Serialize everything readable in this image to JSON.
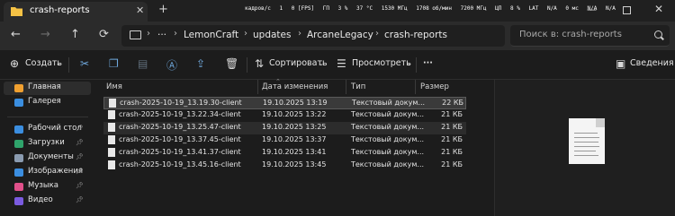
{
  "window": {
    "tab_title": "crash-reports",
    "tab_close_glyph": "✕",
    "new_tab_glyph": "+",
    "minimize_glyph": "—",
    "close_glyph": "✕"
  },
  "overlay": {
    "items": [
      "кадров/с",
      "1",
      "0 [FPS]",
      "ГП",
      "3 %",
      "37 °C",
      "1530 МГц",
      "1708 об/мин",
      "7200 МГц",
      "ЦП",
      "8 %",
      "LAT",
      "N/A",
      "0 мс",
      "N/A",
      "N/A"
    ]
  },
  "nav": {
    "back_glyph": "←",
    "forward_glyph": "→",
    "up_glyph": "↑",
    "refresh_glyph": "⟳"
  },
  "address": {
    "more_glyph": "···",
    "crumbs": [
      "LemonCraft",
      "updates",
      "ArcaneLegacy",
      "crash-reports"
    ]
  },
  "search": {
    "placeholder": "Поиск в: crash-reports"
  },
  "commands": {
    "new_label": "Создать",
    "sort_label": "Сортировать",
    "view_label": "Просмотреть",
    "more_glyph": "···",
    "details_label": "Сведения"
  },
  "sidebar": {
    "items": [
      {
        "label": "Главная",
        "icon": "home-icon",
        "color": "#f0a030",
        "pinned": false
      },
      {
        "label": "Галерея",
        "icon": "gallery-icon",
        "color": "#3b8ee0",
        "pinned": false
      },
      {
        "label": "Рабочий стол",
        "icon": "desktop-icon",
        "color": "#3b8ee0",
        "pinned": true
      },
      {
        "label": "Загрузки",
        "icon": "download-icon",
        "color": "#2fa36b",
        "pinned": true
      },
      {
        "label": "Документы",
        "icon": "documents-icon",
        "color": "#8a9bb0",
        "pinned": true
      },
      {
        "label": "Изображения",
        "icon": "pictures-icon",
        "color": "#3b8ee0",
        "pinned": true
      },
      {
        "label": "Музыка",
        "icon": "music-icon",
        "color": "#e0508a",
        "pinned": true
      },
      {
        "label": "Видео",
        "icon": "video-icon",
        "color": "#7b5be0",
        "pinned": true
      }
    ]
  },
  "columns": {
    "name": "Имя",
    "modified": "Дата изменения",
    "type": "Тип",
    "size": "Размер"
  },
  "files": [
    {
      "name": "crash-2025-10-19_13.19.30-client",
      "modified": "19.10.2025 13:19",
      "type": "Текстовый докум...",
      "size": "22 КБ"
    },
    {
      "name": "crash-2025-10-19_13.22.34-client",
      "modified": "19.10.2025 13:22",
      "type": "Текстовый докум...",
      "size": "21 КБ"
    },
    {
      "name": "crash-2025-10-19_13.25.47-client",
      "modified": "19.10.2025 13:25",
      "type": "Текстовый докум...",
      "size": "21 КБ"
    },
    {
      "name": "crash-2025-10-19_13.37.45-client",
      "modified": "19.10.2025 13:37",
      "type": "Текстовый докум...",
      "size": "21 КБ"
    },
    {
      "name": "crash-2025-10-19_13.41.37-client",
      "modified": "19.10.2025 13:41",
      "type": "Текстовый докум...",
      "size": "21 КБ"
    },
    {
      "name": "crash-2025-10-19_13.45.16-client",
      "modified": "19.10.2025 13:45",
      "type": "Текстовый докум...",
      "size": "21 КБ"
    }
  ],
  "theme": {
    "accent": "#6fa8dc",
    "selection": "#3a3a3a"
  }
}
